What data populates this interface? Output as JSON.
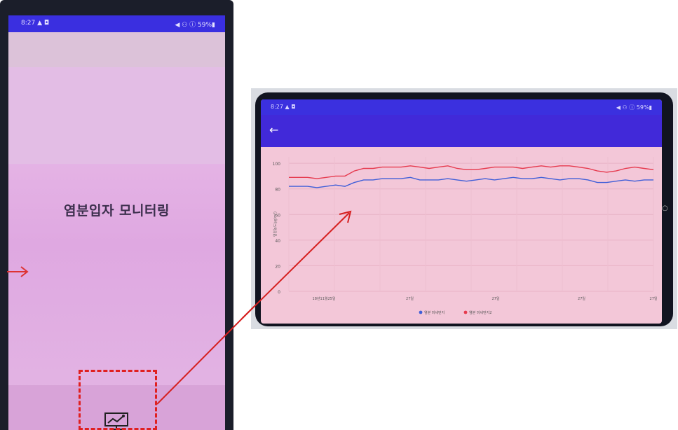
{
  "left_phone": {
    "status_time": "8:27 ▲ ◘",
    "status_right": "◀ ⚇ ⓘ 59%▮",
    "title": "염분입자 모니터링",
    "nav_icon": "monitor-chart-icon",
    "side_arrow": "arrow-right-icon"
  },
  "right_phone": {
    "status_time": "8:27 ▲ ◘",
    "status_right": "◀ ⚇ ⓘ 59%▮",
    "back_icon": "←",
    "side_button_icon": "○"
  },
  "chart_data": {
    "type": "line",
    "x": [
      0,
      1,
      2,
      3,
      4,
      5,
      6,
      7,
      8,
      9,
      10,
      11,
      12,
      13,
      14,
      15,
      16,
      17,
      18,
      19,
      20,
      21,
      22,
      23,
      24,
      25,
      26,
      27,
      28,
      29,
      30,
      31,
      32,
      33,
      34,
      35,
      36,
      37,
      38,
      39
    ],
    "x_tick_labels": [
      "18년11월25일",
      "27일",
      "27일",
      "27일",
      "27일"
    ],
    "yticks": [
      0,
      20,
      40,
      60,
      80,
      100
    ],
    "ylim": [
      0,
      105
    ],
    "ylabel": "염분농도(㎍/m³)",
    "series": [
      {
        "name": "염분 미세먼지",
        "color": "#3f5ed8",
        "values": [
          82,
          82,
          82,
          81,
          82,
          83,
          82,
          85,
          87,
          87,
          88,
          88,
          88,
          89,
          87,
          87,
          87,
          88,
          87,
          86,
          87,
          88,
          87,
          88,
          89,
          88,
          88,
          89,
          88,
          87,
          88,
          88,
          87,
          85,
          85,
          86,
          87,
          86,
          87,
          87
        ]
      },
      {
        "name": "염분 미세먼지2",
        "color": "#e63a4e",
        "values": [
          89,
          89,
          89,
          88,
          89,
          90,
          90,
          94,
          96,
          96,
          97,
          97,
          97,
          98,
          97,
          96,
          97,
          98,
          96,
          95,
          95,
          96,
          97,
          97,
          97,
          96,
          97,
          98,
          97,
          98,
          98,
          97,
          96,
          94,
          93,
          94,
          96,
          97,
          96,
          95
        ]
      }
    ],
    "legend_position": "bottom",
    "grid": true
  },
  "colors": {
    "status_bar": "#3a2fe0",
    "app_bar": "#4129d9",
    "screen_pink": "#f3c7d8",
    "annotation_red": "#e02020"
  }
}
